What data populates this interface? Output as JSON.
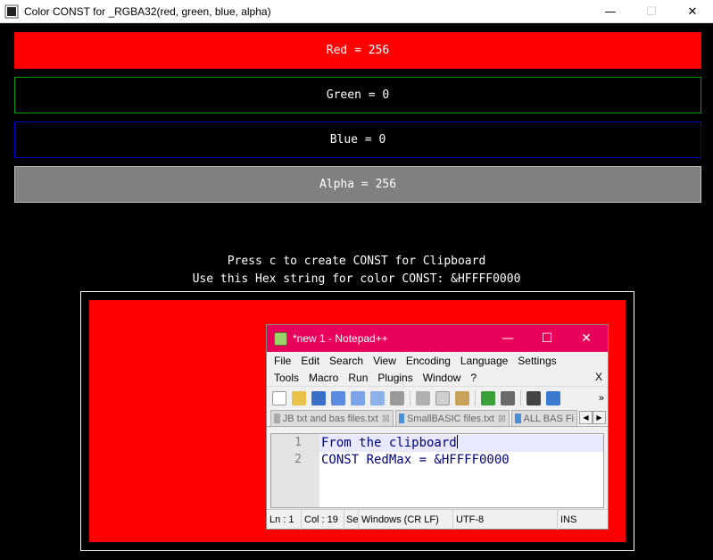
{
  "window": {
    "title": "Color CONST for _RGBA32(red, green, blue, alpha)",
    "minimize": "—",
    "maximize": "☐",
    "close": "✕"
  },
  "bars": {
    "red": "Red = 256",
    "green": "Green = 0",
    "blue": "Blue = 0",
    "alpha": "Alpha = 256"
  },
  "messages": {
    "line1": "Press c to create CONST for Clipboard",
    "line2": "Use this Hex string for color CONST: &HFFFF0000"
  },
  "colors": {
    "preview": "#ff0000",
    "notepad_title": "#e8005a"
  },
  "notepad": {
    "title": "*new 1 - Notepad++",
    "minimize": "—",
    "maximize": "☐",
    "close": "✕",
    "menu_row1": [
      "File",
      "Edit",
      "Search",
      "View",
      "Encoding",
      "Language",
      "Settings"
    ],
    "menu_row2": [
      "Tools",
      "Macro",
      "Run",
      "Plugins",
      "Window",
      "?"
    ],
    "menu_close": "X",
    "toolbar_more": "»",
    "tabs": [
      "JB txt and bas files.txt",
      "SmallBASIC files.txt",
      "ALL BAS Fi"
    ],
    "tab_close": "⊠",
    "tab_prev": "◀",
    "tab_next": "▶",
    "lines": [
      {
        "num": "1",
        "text": "From the clipboard"
      },
      {
        "num": "2",
        "text": "CONST RedMax = &HFFFF0000"
      }
    ],
    "status": {
      "ln": "Ln : 1",
      "col": "Col : 19",
      "sel": "Se",
      "eol": "Windows (CR LF)",
      "encoding": "UTF-8",
      "mode": "INS"
    }
  }
}
